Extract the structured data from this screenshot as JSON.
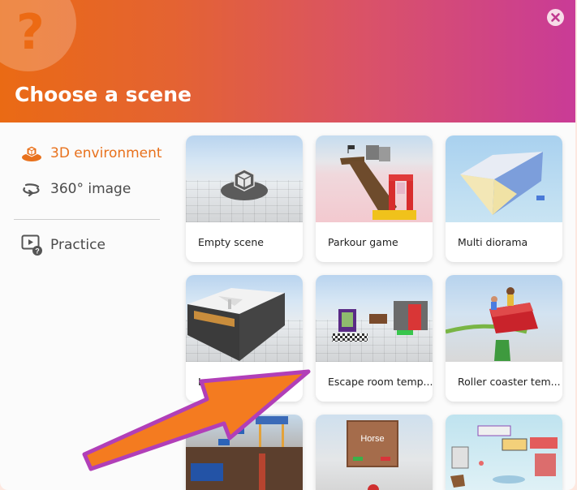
{
  "dialog": {
    "title": "Choose a scene",
    "help_symbol": "?",
    "close_symbol": "✕"
  },
  "sidebar": {
    "items": [
      {
        "label": "3D environment",
        "icon": "cube-icon",
        "active": true
      },
      {
        "label": "360° image",
        "icon": "rotate-360-icon",
        "active": false
      },
      {
        "label": "Practice",
        "icon": "video-help-icon",
        "active": false
      }
    ]
  },
  "scenes": [
    {
      "label": "Empty scene"
    },
    {
      "label": "Parkour game"
    },
    {
      "label": "Multi diorama"
    },
    {
      "label": "Large gallery"
    },
    {
      "label": "Escape room temp..."
    },
    {
      "label": "Roller coaster tem..."
    },
    {
      "label": ""
    },
    {
      "label": ""
    },
    {
      "label": ""
    }
  ],
  "thumb_texts": {
    "horse": "Horse"
  },
  "colors": {
    "accent": "#e8711c",
    "header_start": "#ea6a14",
    "header_end": "#c93b97",
    "annotation_arrow": "#f47b20",
    "annotation_arrow_outline": "#b13fb8"
  }
}
